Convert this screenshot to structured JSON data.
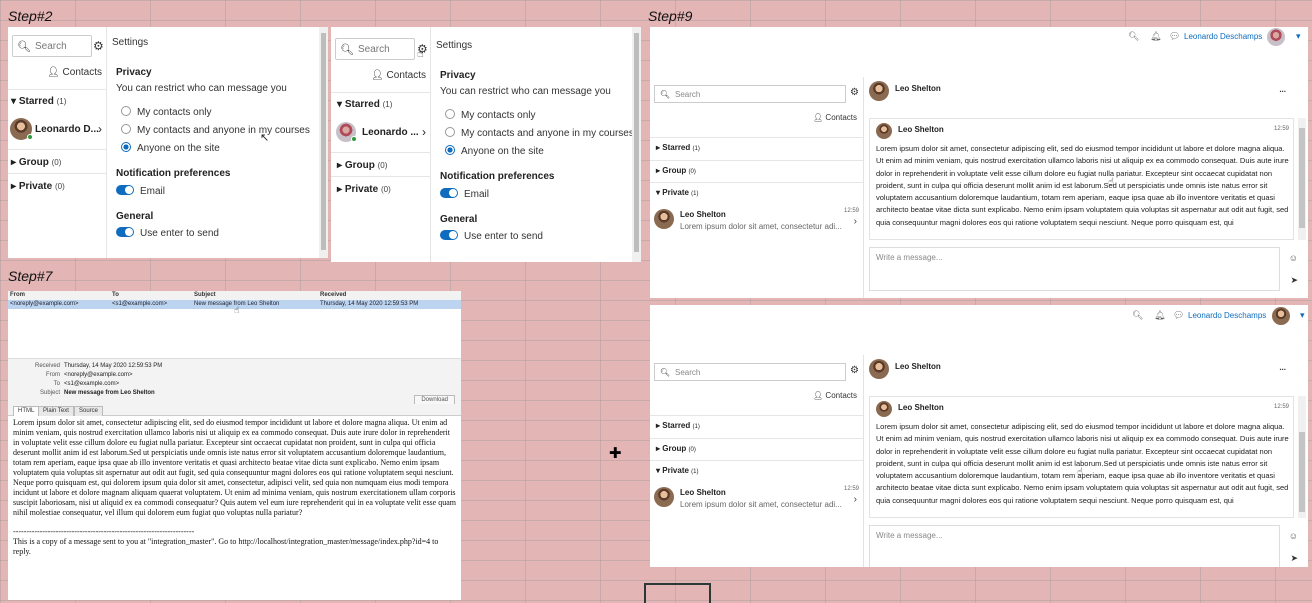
{
  "steps": {
    "step2": "Step#2",
    "step7": "Step#7",
    "step9": "Step#9"
  },
  "settings": {
    "search_placeholder": "Search",
    "title": "Settings",
    "contacts_label": "Contacts",
    "starred_label": "Starred",
    "starred_count": "(1)",
    "group_label": "Group",
    "group_count": "(0)",
    "private_label": "Private",
    "private_count": "(0)",
    "contact_name_a": "Leonardo D...",
    "contact_name_b": "Leonardo ...",
    "privacy_heading": "Privacy",
    "privacy_desc": "You can restrict who can message you",
    "opt_contacts_only": "My contacts only",
    "opt_contacts_courses": "My contacts and anyone in my courses",
    "opt_anyone": "Anyone on the site",
    "notif_heading": "Notification preferences",
    "email_label": "Email",
    "general_heading": "General",
    "enter_label": "Use enter to send"
  },
  "email": {
    "columns": {
      "from": "From",
      "to": "To",
      "subject": "Subject",
      "received": "Received"
    },
    "row": {
      "from": "<noreply@example.com>",
      "to": "<s1@example.com>",
      "subject": "New message from Leo Shelton",
      "received": "Thursday, 14 May 2020 12:59:53 PM"
    },
    "meta": {
      "received_key": "Received",
      "received_val": "Thursday, 14 May 2020 12:59:53 PM",
      "from_key": "From",
      "from_val": "<noreply@example.com>",
      "to_key": "To",
      "to_val": "<s1@example.com>",
      "subject_key": "Subject",
      "subject_val": "New message from Leo Shelton"
    },
    "tabs": [
      "HTML",
      "Plain Text",
      "Source"
    ],
    "download_label": "Download",
    "body": "Lorem ipsum dolor sit amet, consectetur adipiscing elit, sed do eiusmod tempor incididunt ut labore et dolore magna aliqua. Ut enim ad minim veniam, quis nostrud exercitation ullamco laboris nisi ut aliquip ex ea commodo consequat. Duis aute irure dolor in reprehenderit in voluptate velit esse cillum dolore eu fugiat nulla pariatur. Excepteur sint occaecat cupidatat non proident, sunt in culpa qui officia deserunt mollit anim id est laborum.Sed ut perspiciatis unde omnis iste natus error sit voluptatem accusantium doloremque laudantium, totam rem aperiam, eaque ipsa quae ab illo inventore veritatis et quasi architecto beatae vitae dicta sunt explicabo. Nemo enim ipsam voluptatem quia voluptas sit aspernatur aut odit aut fugit, sed quia consequuntur magni dolores eos qui ratione voluptatem sequi nesciunt. Neque porro quisquam est, qui dolorem ipsum quia dolor sit amet, consectetur, adipisci velit, sed quia non numquam eius modi tempora incidunt ut labore et dolore magnam aliquam quaerat voluptatem. Ut enim ad minima veniam, quis nostrum exercitationem ullam corporis suscipit laboriosam, nisi ut aliquid ex ea commodi consequatur? Quis autem vel eum iure reprehenderit qui in ea voluptate velit esse quam nihil molestiae consequatur, vel illum qui dolorem eum fugiat quo voluptas nulla pariatur?",
    "separator": "--------------------------------------------------------------------",
    "footer": "This is a copy of a message sent to you at \"integration_master\". Go to http://localhost/integration_master/message/index.php?id=4 to reply."
  },
  "messaging": {
    "user_name": "Leonardo Deschamps",
    "search_placeholder": "Search",
    "contacts_label": "Contacts",
    "starred_label": "Starred",
    "starred_count": "(1)",
    "group_label": "Group",
    "group_count": "(0)",
    "private_label": "Private",
    "private_count": "(1)",
    "conv_name": "Leo Shelton",
    "conv_time": "12:59",
    "conv_preview": "Lorem ipsum dolor sit amet, consectetur adi...",
    "header_name": "Leo Shelton",
    "msg_name": "Leo Shelton",
    "msg_time": "12:59",
    "msg_text": "Lorem ipsum dolor sit amet, consectetur adipiscing elit, sed do eiusmod tempor incididunt ut labore et dolore magna aliqua. Ut enim ad minim veniam, quis nostrud exercitation ullamco laboris nisi ut aliquip ex ea commodo consequat. Duis aute irure dolor in reprehenderit in voluptate velit esse cillum dolore eu fugiat nulla pariatur. Excepteur sint occaecat cupidatat non proident, sunt in culpa qui officia deserunt mollit anim id est laborum.Sed ut perspiciatis unde omnis iste natus error sit voluptatem accusantium doloremque laudantium, totam rem aperiam, eaque ipsa quae ab illo inventore veritatis et quasi architecto beatae vitae dicta sunt explicabo. Nemo enim ipsam voluptatem quia voluptas sit aspernatur aut odit aut fugit, sed quia consequuntur magni dolores eos qui ratione voluptatem sequi nesciunt. Neque porro quisquam est, qui",
    "compose_placeholder": "Write a message...",
    "more_label": "..."
  },
  "icons": {
    "search": "search-icon",
    "gear": "gear-icon",
    "user": "user-icon",
    "chevron_right": "chevron-right-icon",
    "caret_down": "caret-down-icon",
    "caret_right": "caret-right-icon",
    "bell": "bell-icon",
    "chat": "chat-icon",
    "emoji": "emoji-icon",
    "send": "send-icon",
    "move": "move-cursor-icon",
    "pointer": "mouse-pointer-icon",
    "hand": "hand-cursor-icon"
  },
  "colors": {
    "accent": "#0f6cbf",
    "background": "#e3b5b5",
    "online": "#2e9c3d"
  }
}
